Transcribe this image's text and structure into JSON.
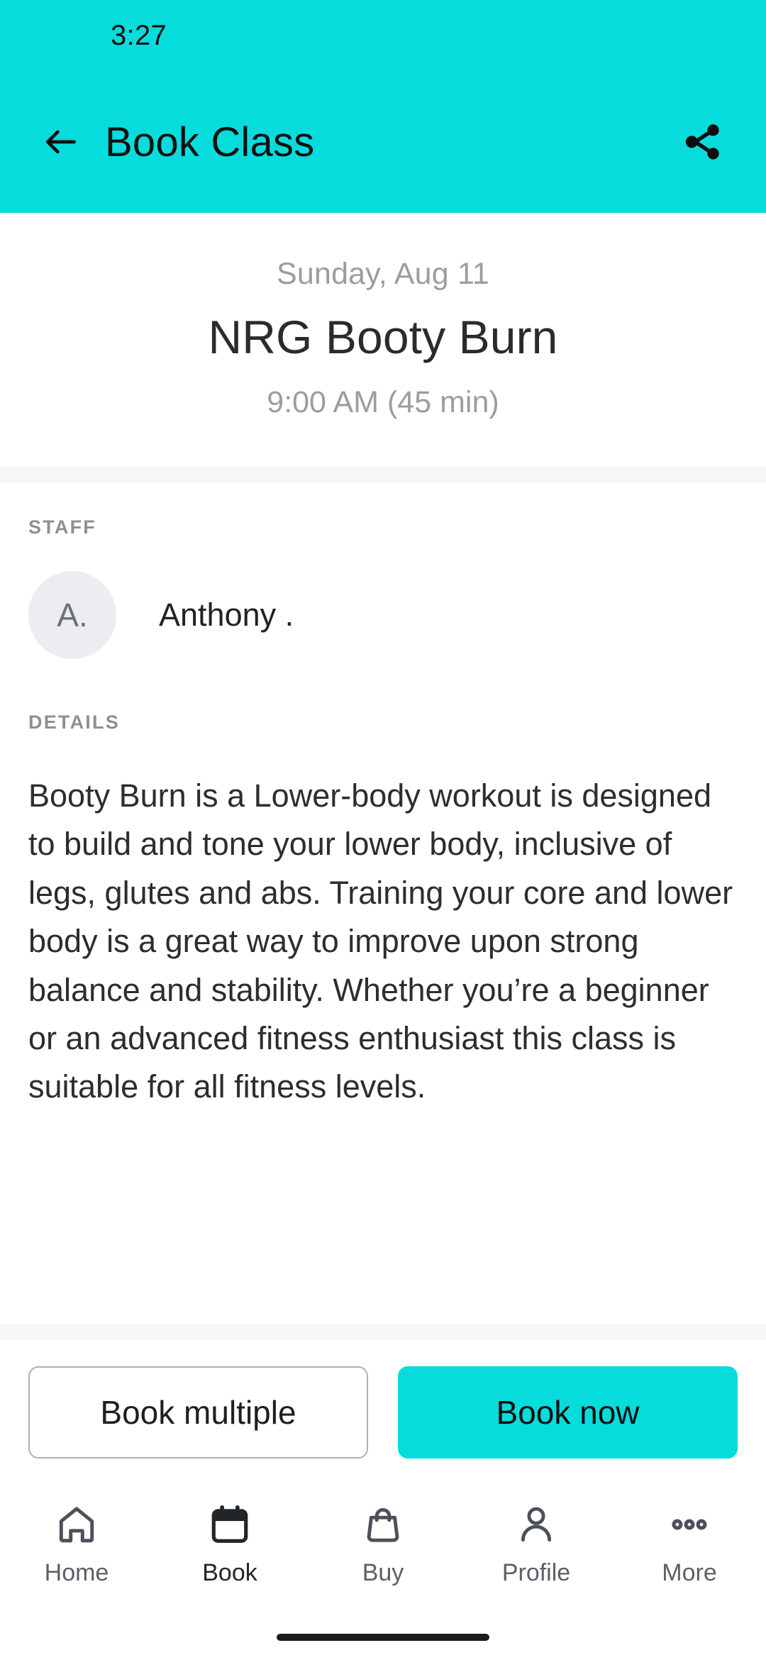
{
  "theme": {
    "accent": "#06dcdc",
    "surface": "#ffffff",
    "band": "#f4f6f8",
    "muted_text": "#9a9da2",
    "body_text": "#2d2d2d"
  },
  "status_bar": {
    "time": "3:27"
  },
  "app_bar": {
    "back_icon": "arrow-left-icon",
    "title": "Book Class",
    "share_icon": "share-icon"
  },
  "hero": {
    "date": "Sunday, Aug 11",
    "class_name": "NRG Booty Burn",
    "time": "9:00 AM (45 min)"
  },
  "staff": {
    "label": "STAFF",
    "avatar_initials": "A.",
    "name": "Anthony ."
  },
  "details": {
    "label": "DETAILS",
    "text": "Booty Burn is a Lower-body workout is designed to build and tone your lower body, inclusive of legs, glutes and abs. Training your core and lower body is a great way to improve upon strong balance and stability. Whether you’re a beginner or an advanced fitness enthusiast this class is suitable for all fitness levels."
  },
  "actions": {
    "secondary_label": "Book multiple",
    "primary_label": "Book now"
  },
  "bottom_nav": {
    "items": [
      {
        "label": "Home",
        "icon": "home-icon",
        "active": false
      },
      {
        "label": "Book",
        "icon": "calendar-icon",
        "active": true
      },
      {
        "label": "Buy",
        "icon": "shopping-bag-icon",
        "active": false
      },
      {
        "label": "Profile",
        "icon": "person-icon",
        "active": false
      },
      {
        "label": "More",
        "icon": "more-dots-icon",
        "active": false
      }
    ]
  }
}
